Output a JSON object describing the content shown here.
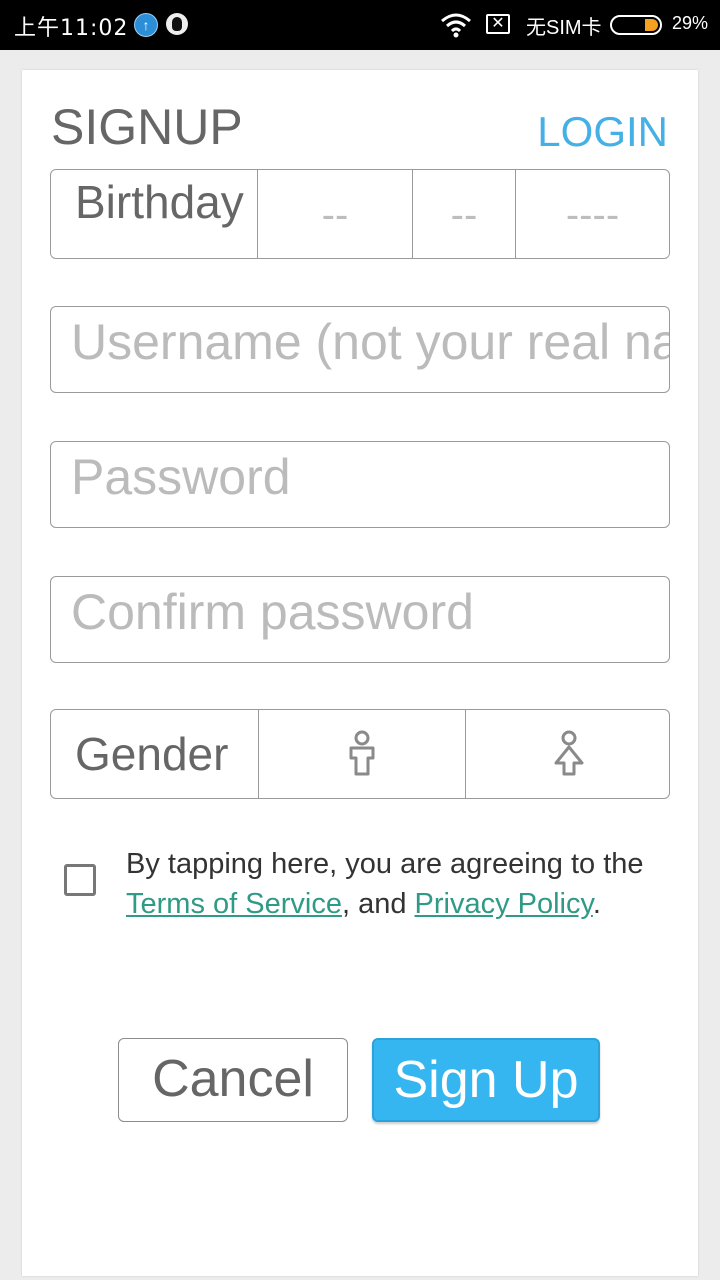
{
  "status_bar": {
    "time": "上午11:02",
    "carrier": "无SIM卡",
    "battery": "29%",
    "nosim_glyph": "✕"
  },
  "header": {
    "title": "SIGNUP",
    "login_link": "LOGIN"
  },
  "birthday": {
    "label": "Birthday",
    "month_placeholder": "--",
    "day_placeholder": "--",
    "year_placeholder": "----"
  },
  "fields": {
    "username_placeholder": "Username (not your real name)",
    "password_placeholder": "Password",
    "confirm_placeholder": "Confirm password"
  },
  "gender": {
    "label": "Gender",
    "options": [
      "male-icon",
      "female-icon"
    ]
  },
  "agreement": {
    "checked": false,
    "text_before": "By tapping here, you are agreeing to the ",
    "terms_link": "Terms of Service",
    "text_middle": ", and ",
    "privacy_link": "Privacy Policy",
    "text_after": "."
  },
  "buttons": {
    "cancel": "Cancel",
    "signup": "Sign Up"
  },
  "colors": {
    "accent": "#45b0e6",
    "primary_button": "#35b6f0",
    "link": "#2f9a86",
    "battery": "#f4a020"
  }
}
